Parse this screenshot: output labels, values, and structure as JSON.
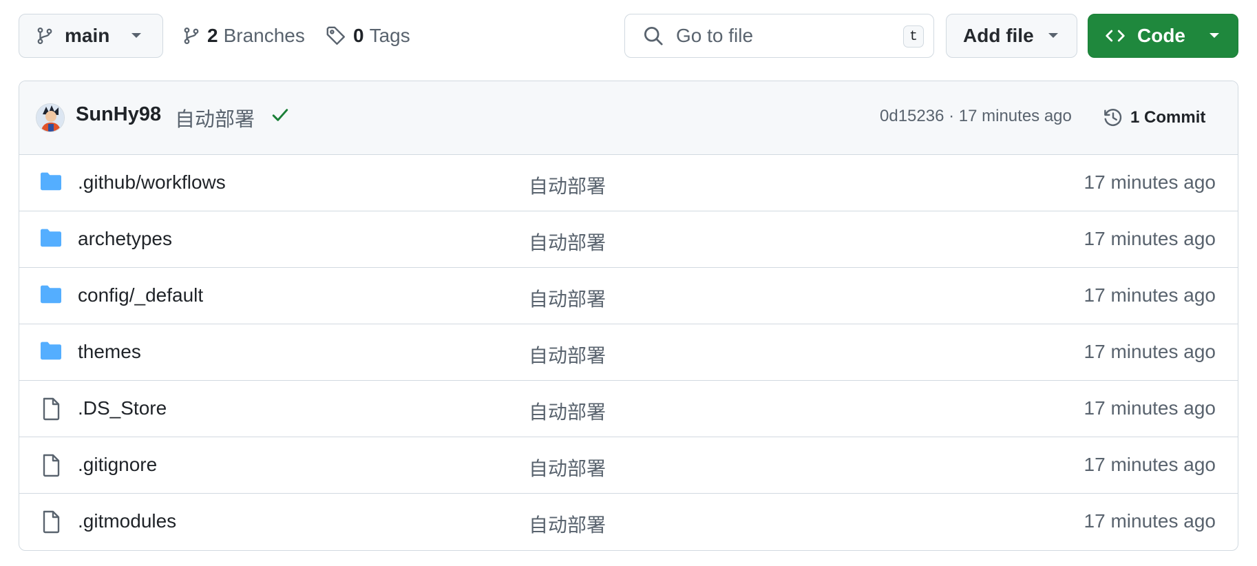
{
  "toolbar": {
    "branch_name": "main",
    "branches_count": "2",
    "branches_label": "Branches",
    "tags_count": "0",
    "tags_label": "Tags",
    "search_placeholder": "Go to file",
    "search_shortcut": "t",
    "add_file_label": "Add file",
    "code_label": "Code"
  },
  "latest_commit": {
    "author": "SunHy98",
    "message": "自动部署",
    "status": "success",
    "hash_and_time": "0d15236 · 17 minutes ago",
    "commits_label": "1 Commit"
  },
  "files": [
    {
      "name": ".github/workflows",
      "type": "folder",
      "message": "自动部署",
      "age": "17 minutes ago"
    },
    {
      "name": "archetypes",
      "type": "folder",
      "message": "自动部署",
      "age": "17 minutes ago"
    },
    {
      "name": "config/_default",
      "type": "folder",
      "message": "自动部署",
      "age": "17 minutes ago"
    },
    {
      "name": "themes",
      "type": "folder",
      "message": "自动部署",
      "age": "17 minutes ago"
    },
    {
      "name": ".DS_Store",
      "type": "file",
      "message": "自动部署",
      "age": "17 minutes ago"
    },
    {
      "name": ".gitignore",
      "type": "file",
      "message": "自动部署",
      "age": "17 minutes ago"
    },
    {
      "name": ".gitmodules",
      "type": "file",
      "message": "自动部署",
      "age": "17 minutes ago"
    }
  ],
  "colors": {
    "folder": "#54aeff",
    "file_icon": "#59636e",
    "success": "#1a7f37",
    "code_button": "#1f883d",
    "border": "#d1d9e0"
  }
}
